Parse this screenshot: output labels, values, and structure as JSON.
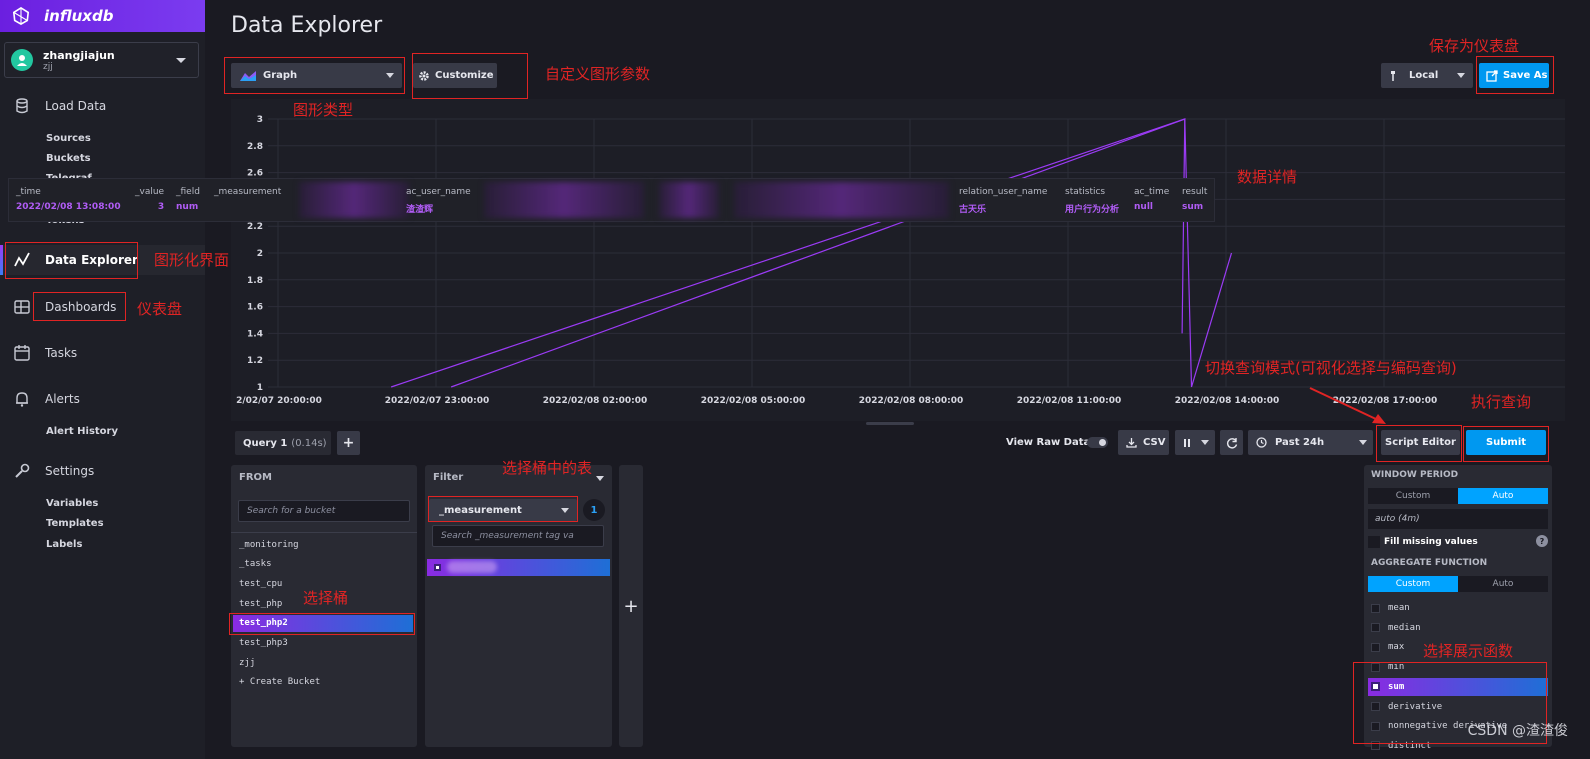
{
  "app": {
    "logo_text": "influxdb"
  },
  "user": {
    "name": "zhangjiajun",
    "org": "zjj"
  },
  "nav": {
    "load_data": "Load Data",
    "load_data_subs": [
      "Sources",
      "Buckets",
      "Telegraf",
      "Tokens"
    ],
    "data_explorer": "Data Explorer",
    "dashboards": "Dashboards",
    "tasks": "Tasks",
    "alerts": "Alerts",
    "alerts_subs": [
      "Alert History"
    ],
    "settings": "Settings",
    "settings_subs": [
      "Variables",
      "Templates",
      "Labels"
    ]
  },
  "header": {
    "title": "Data Explorer",
    "graph_type": "Graph",
    "customize": "Customize",
    "timezone": "Local",
    "save_as": "Save As"
  },
  "tooltip": {
    "columns": [
      {
        "header": "_time",
        "value": "2022/02/08 13:08:00"
      },
      {
        "header": "_value",
        "value": "3"
      },
      {
        "header": "_field",
        "value": "num"
      },
      {
        "header": "_measurement",
        "value": ""
      },
      {
        "header": "ac_user_name",
        "value": "渣渣辉"
      },
      {
        "header": "relation_user_name",
        "value": "古天乐"
      },
      {
        "header": "statistics",
        "value": "用户行为分析"
      },
      {
        "header": "ac_time",
        "value": "null"
      },
      {
        "header": "result",
        "value": "sum"
      }
    ]
  },
  "chart_data": {
    "type": "line",
    "series_color": "#9b3bf5",
    "y_ticks": [
      "3",
      "2.8",
      "2.6",
      "2.4",
      "2.2",
      "2",
      "1.8",
      "1.6",
      "1.4",
      "1.2",
      "1"
    ],
    "x_ticks": [
      "2/02/07 20:00:00",
      "2022/02/07 23:00:00",
      "2022/02/08 02:00:00",
      "2022/02/08 05:00:00",
      "2022/02/08 08:00:00",
      "2022/02/08 11:00:00",
      "2022/02/08 14:00:00",
      "2022/02/08 17:00:00"
    ],
    "ylim": [
      1,
      3
    ],
    "grid": true,
    "series": [
      {
        "points": [
          [
            0.12,
            1
          ],
          [
            0.715,
            3
          ],
          [
            0.713,
            1.4
          ]
        ]
      },
      {
        "points": [
          [
            0.165,
            1
          ],
          [
            0.715,
            3
          ],
          [
            0.72,
            1
          ],
          [
            0.75,
            2
          ]
        ]
      }
    ]
  },
  "query": {
    "tab": "Query 1",
    "time": "(0.14s)",
    "add": "+",
    "view_raw": "View Raw Data",
    "csv": "CSV",
    "time_range": "Past 24h",
    "script_editor": "Script Editor",
    "submit": "Submit"
  },
  "from": {
    "title": "FROM",
    "search_placeholder": "Search for a bucket",
    "buckets": [
      "_monitoring",
      "_tasks",
      "test_cpu",
      "test_php",
      "test_php2",
      "test_php3",
      "zjj",
      "+ Create Bucket"
    ],
    "selected": "test_php2"
  },
  "filter": {
    "title": "Filter",
    "key": "_measurement",
    "count": "1",
    "search_placeholder": "Search _measurement tag va"
  },
  "window": {
    "title": "WINDOW PERIOD",
    "custom": "Custom",
    "auto": "Auto",
    "auto_value": "auto (4m)",
    "fill_missing": "Fill missing values",
    "help": "?"
  },
  "aggregate": {
    "title": "AGGREGATE FUNCTION",
    "custom": "Custom",
    "auto": "Auto",
    "functions": [
      "mean",
      "median",
      "max",
      "min",
      "sum",
      "derivative",
      "nonnegative derivative",
      "distinct"
    ],
    "selected": "sum"
  },
  "annotations": {
    "graph_type": "图形类型",
    "customize": "自定义图形参数",
    "save_as": "保存为仪表盘",
    "data_detail": "数据详情",
    "data_explorer": "图形化界面",
    "dashboards": "仪表盘",
    "switch_mode": "切换查询模式(可视化选择与编码查询)",
    "submit": "执行查询",
    "select_table": "选择桶中的表",
    "select_bucket": "选择桶",
    "select_func": "选择展示函数"
  },
  "watermark": "CSDN @渣渣俊"
}
